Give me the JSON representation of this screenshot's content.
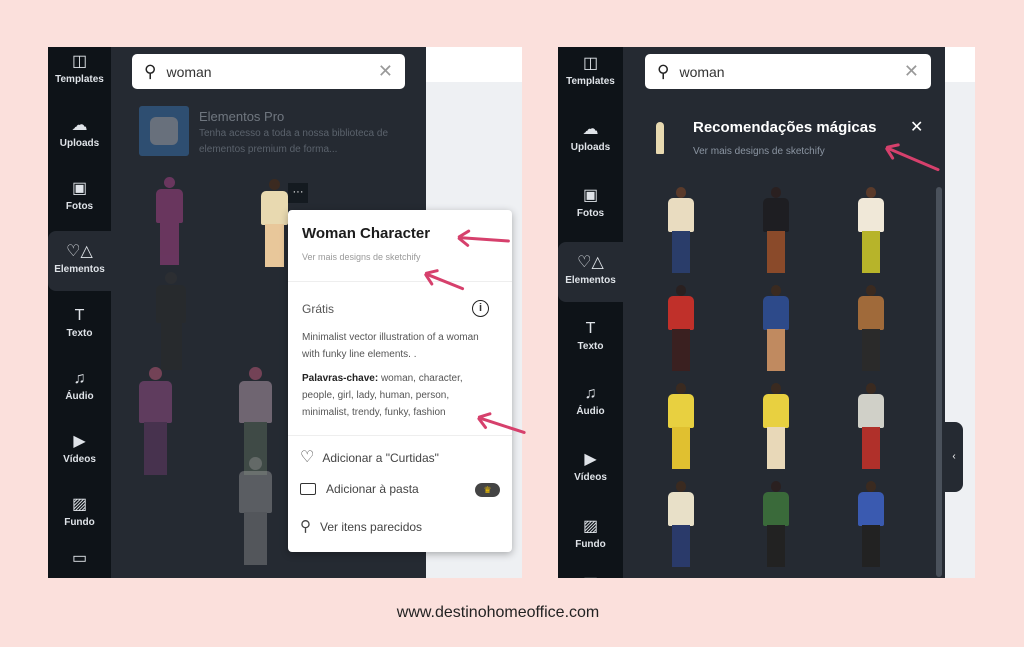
{
  "sidebar_items": [
    "Templates",
    "Uploads",
    "Fotos",
    "Elementos",
    "Texto",
    "Áudio",
    "Vídeos",
    "Fundo"
  ],
  "sidebar_icons": [
    "template-icon",
    "upload-icon",
    "photo-icon",
    "elements-icon",
    "text-icon",
    "audio-icon",
    "video-icon",
    "background-icon"
  ],
  "left": {
    "search_value": "woman",
    "pro_banner": {
      "title": "Elementos Pro",
      "desc": "Tenha acesso a toda a nossa biblioteca de elementos premium de forma..."
    },
    "more_button": "···",
    "popup": {
      "title": "Woman Character",
      "subtitle": "Ver mais designs de sketchify",
      "price": "Grátis",
      "description": "Minimalist vector illustration of a woman with funky line elements. .",
      "keywords_label": "Palavras-chave:",
      "keywords": " woman, character, people, girl, lady, human, person, minimalist, trendy, funky, fashion",
      "actions": [
        "Adicionar a \"Curtidas\"",
        "Adicionar à pasta",
        "Ver itens parecidos"
      ]
    }
  },
  "right": {
    "search_value": "woman",
    "title": "Recomendações mágicas",
    "subtitle": "Ver mais designs de sketchify"
  },
  "footer": "www.destinohomeoffice.com",
  "colors": {
    "background": "#fbe0dc",
    "sidebar": "#0e1318",
    "panel": "#252a32",
    "arrow": "#d6406c"
  }
}
